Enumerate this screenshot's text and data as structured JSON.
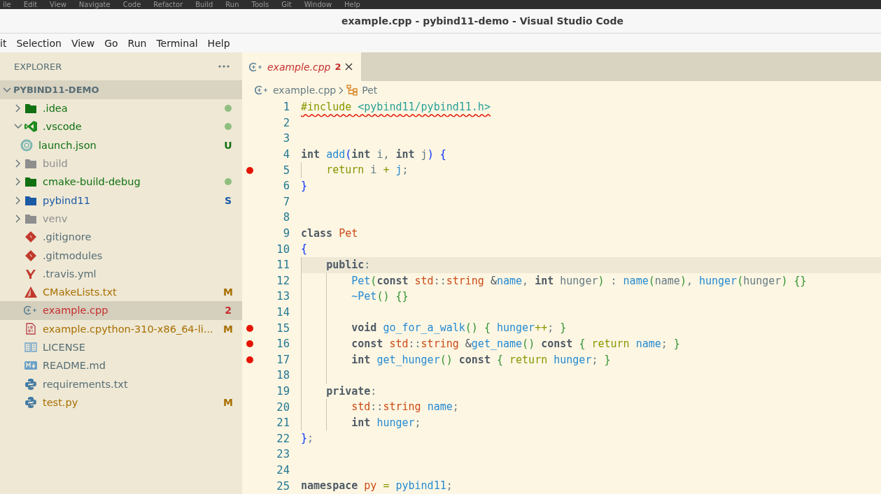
{
  "ide_menu_strip": [
    "ile",
    "Edit",
    "View",
    "Navigate",
    "Code",
    "Refactor",
    "Build",
    "Run",
    "Tools",
    "Git",
    "Window",
    "Help"
  ],
  "window": {
    "title": "example.cpp - pybind11-demo - Visual Studio Code"
  },
  "menu": [
    "it",
    "Selection",
    "View",
    "Go",
    "Run",
    "Terminal",
    "Help"
  ],
  "sidebar": {
    "title": "EXPLORER",
    "root": {
      "label": "PYBIND11-DEMO",
      "expanded": true
    },
    "items": [
      {
        "name": ".idea",
        "kind": "folder",
        "color": "#117011",
        "dot": true,
        "expanded": false,
        "selected": false
      },
      {
        "name": ".vscode",
        "kind": "vscode",
        "color": "#117011",
        "dot": true,
        "expanded": true,
        "selected": false,
        "children": [
          {
            "name": "launch.json",
            "kind": "json",
            "color": "#117011",
            "badge": "U",
            "selected": false
          }
        ]
      },
      {
        "name": "build",
        "kind": "folder",
        "color": "#8e8e8e",
        "expanded": false,
        "selected": false
      },
      {
        "name": "cmake-build-debug",
        "kind": "folder",
        "color": "#117011",
        "dot": true,
        "expanded": false,
        "selected": false
      },
      {
        "name": "pybind11",
        "kind": "folder",
        "color": "#1d5aa6",
        "badge": "S",
        "expanded": false,
        "selected": false
      },
      {
        "name": "venv",
        "kind": "folder",
        "color": "#8e8e8e",
        "expanded": false,
        "selected": false
      },
      {
        "name": ".gitignore",
        "kind": "git",
        "color": "#586e75",
        "selected": false
      },
      {
        "name": ".gitmodules",
        "kind": "git",
        "color": "#586e75",
        "selected": false
      },
      {
        "name": ".travis.yml",
        "kind": "yaml",
        "color": "#586e75",
        "selected": false
      },
      {
        "name": "CMakeLists.txt",
        "kind": "cmake",
        "color": "#a86f00",
        "badge": "M",
        "selected": false
      },
      {
        "name": "example.cpp",
        "kind": "cpp",
        "color": "#c62d2d",
        "badge": "2",
        "selected": true
      },
      {
        "name": "example.cpython-310-x86_64-li...",
        "kind": "binary",
        "color": "#a86f00",
        "badge": "M",
        "selected": false
      },
      {
        "name": "LICENSE",
        "kind": "license",
        "color": "#586e75",
        "selected": false
      },
      {
        "name": "README.md",
        "kind": "markdown",
        "color": "#586e75",
        "selected": false
      },
      {
        "name": "requirements.txt",
        "kind": "python",
        "color": "#586e75",
        "selected": false
      },
      {
        "name": "test.py",
        "kind": "python",
        "color": "#a86f00",
        "badge": "M",
        "selected": false
      }
    ]
  },
  "editor": {
    "tabs": [
      {
        "label": "example.cpp",
        "badge": "2",
        "preview": true,
        "selected": true
      }
    ],
    "breadcrumb": [
      {
        "kind": "cpp",
        "label": "example.cpp"
      },
      {
        "kind": "class",
        "label": "Pet"
      }
    ],
    "lines": [
      {
        "number": "1",
        "breakpoint": false,
        "selected": false,
        "squiggle": true,
        "code": "#include <pybind11/pybind11.h>"
      },
      {
        "number": "2",
        "breakpoint": false,
        "selected": false
      },
      {
        "number": "3",
        "breakpoint": false,
        "selected": false
      },
      {
        "number": "4",
        "breakpoint": false,
        "selected": false,
        "squiggle": false,
        "code": "int add(int i, int j) {"
      },
      {
        "number": "5",
        "breakpoint": true,
        "selected": false,
        "squiggle": false,
        "code": "    return i + j;"
      },
      {
        "number": "6",
        "breakpoint": false,
        "selected": false,
        "squiggle": false,
        "code": "}"
      },
      {
        "number": "7",
        "breakpoint": false,
        "selected": false
      },
      {
        "number": "8",
        "breakpoint": false,
        "selected": false
      },
      {
        "number": "9",
        "breakpoint": false,
        "selected": false,
        "squiggle": false,
        "code": "class Pet"
      },
      {
        "number": "10",
        "breakpoint": false,
        "selected": false,
        "squiggle": false,
        "code": "{"
      },
      {
        "number": "11",
        "breakpoint": false,
        "selected": true,
        "squiggle": false,
        "code": "    public:"
      },
      {
        "number": "12",
        "breakpoint": false,
        "selected": false,
        "squiggle": false,
        "code": "        Pet(const std::string &name, int hunger) : name(name), hunger(hunger) {}"
      },
      {
        "number": "13",
        "breakpoint": false,
        "selected": false,
        "squiggle": false,
        "code": "        ~Pet() {}"
      },
      {
        "number": "14",
        "breakpoint": false,
        "selected": false
      },
      {
        "number": "15",
        "breakpoint": true,
        "selected": false,
        "squiggle": false,
        "code": "        void go_for_a_walk() { hunger++; }"
      },
      {
        "number": "16",
        "breakpoint": true,
        "selected": false,
        "squiggle": false,
        "code": "        const std::string &get_name() const { return name; }"
      },
      {
        "number": "17",
        "breakpoint": true,
        "selected": false,
        "squiggle": false,
        "code": "        int get_hunger() const { return hunger; }"
      },
      {
        "number": "18",
        "breakpoint": false,
        "selected": false
      },
      {
        "number": "19",
        "breakpoint": false,
        "selected": false,
        "squiggle": false,
        "code": "    private:"
      },
      {
        "number": "20",
        "breakpoint": false,
        "selected": false,
        "squiggle": false,
        "code": "        std::string name;"
      },
      {
        "number": "21",
        "breakpoint": false,
        "selected": false,
        "squiggle": false,
        "code": "        int hunger;"
      },
      {
        "number": "22",
        "breakpoint": false,
        "selected": false,
        "squiggle": false,
        "code": "};"
      },
      {
        "number": "23",
        "breakpoint": false,
        "selected": false
      },
      {
        "number": "24",
        "breakpoint": false,
        "selected": false
      },
      {
        "number": "25",
        "breakpoint": false,
        "selected": false,
        "squiggle": false,
        "code": "namespace py = pybind11;"
      }
    ]
  }
}
